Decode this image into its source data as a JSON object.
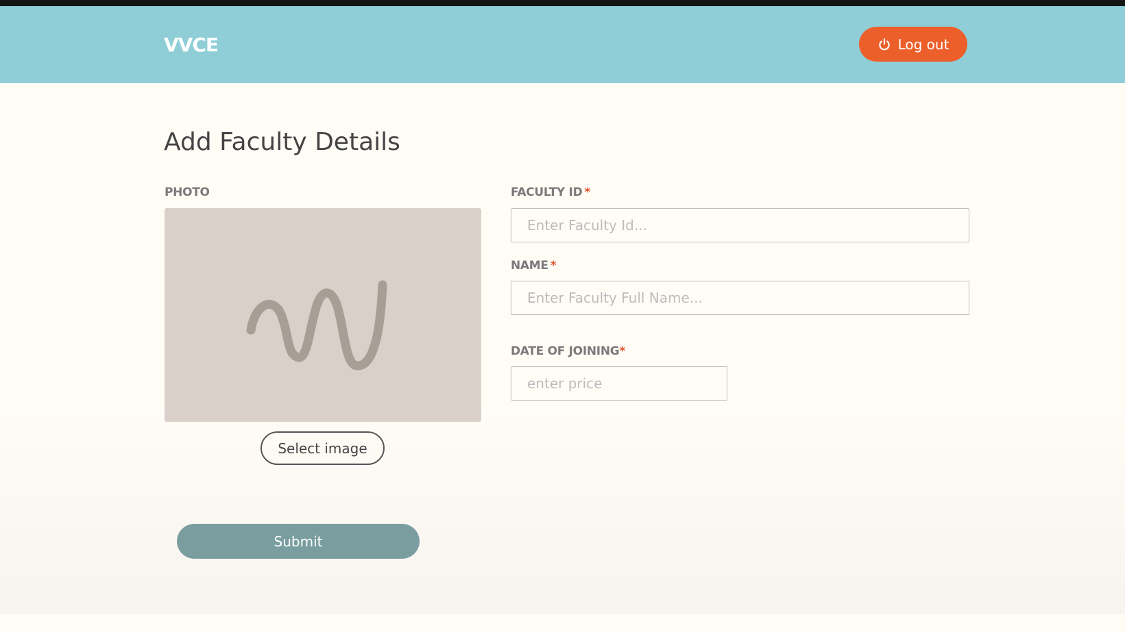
{
  "header": {
    "logo": "VVCE",
    "logout_label": "Log out",
    "bg_color": "#8fced6",
    "logout_color": "#ec5f2a"
  },
  "page": {
    "title": "Add Faculty Details"
  },
  "photo": {
    "label": "PHOTO",
    "select_label": "Select image",
    "placeholder_icon": "squiggle-placeholder-icon"
  },
  "form": {
    "faculty_id": {
      "label": "FACULTY ID",
      "required": "*",
      "value": "",
      "placeholder": "Enter Faculty Id..."
    },
    "name": {
      "label": "NAME",
      "required": "*",
      "value": "",
      "placeholder": "Enter Faculty Full Name..."
    },
    "date_of_joining": {
      "label": "DATE OF JOINING",
      "required": "*",
      "value": "",
      "placeholder": "enter price"
    }
  },
  "submit": {
    "label": "Submit",
    "color": "#7a9e9f"
  }
}
